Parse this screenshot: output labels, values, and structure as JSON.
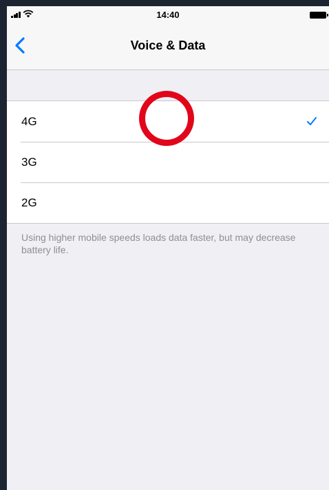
{
  "status_bar": {
    "time": "14:40",
    "signal_icon": "cellular-signal-icon",
    "wifi_icon": "wifi-icon",
    "battery_icon": "battery-icon"
  },
  "nav": {
    "title": "Voice & Data",
    "back_icon": "chevron-left-icon"
  },
  "options": [
    {
      "label": "4G",
      "selected": true
    },
    {
      "label": "3G",
      "selected": false
    },
    {
      "label": "2G",
      "selected": false
    }
  ],
  "footer": "Using higher mobile speeds loads data faster, but may decrease battery life.",
  "colors": {
    "accent": "#007aff",
    "background": "#efeff4",
    "separator": "#c8c7cc",
    "tap_indicator": "#e2061b"
  }
}
